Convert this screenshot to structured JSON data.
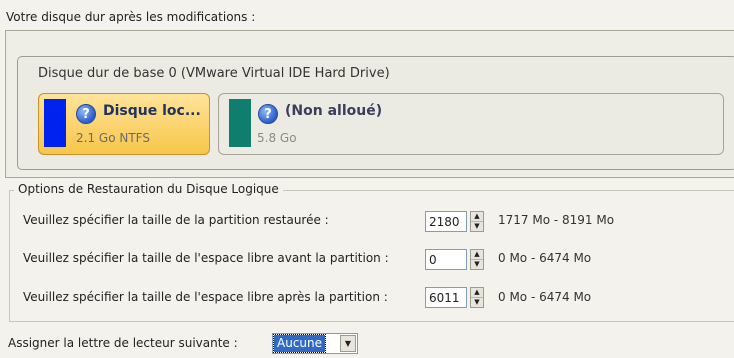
{
  "after_label": "Votre disque dur après les modifications :",
  "disk": {
    "title": "Disque dur de base 0 (VMware Virtual IDE Hard Drive)",
    "partitions": [
      {
        "name": "Disque loc...",
        "size": "2.1 Go NTFS",
        "color": "#0022ee",
        "icon": "question-icon",
        "selected": true
      },
      {
        "name": "(Non alloué)",
        "size": "5.8 Go",
        "color": "#0f7e6e",
        "icon": "question-icon",
        "selected": false
      }
    ]
  },
  "options": {
    "legend": "Options de Restauration du Disque Logique",
    "rows": [
      {
        "label": "Veuillez spécifier la taille de la partition restaurée :",
        "value": "2180",
        "range": "1717 Mo - 8191 Mo"
      },
      {
        "label": "Veuillez spécifier la taille de l'espace libre avant la partition :",
        "value": "0",
        "range": "0 Mo - 6474 Mo"
      },
      {
        "label": "Veuillez spécifier la taille de l'espace libre après la partition :",
        "value": "6011",
        "range": "0 Mo - 6474 Mo"
      }
    ]
  },
  "assign": {
    "label": "Assigner la lettre de lecteur suivante :",
    "selected": "Aucune"
  },
  "icons": {
    "spin_up": "▲",
    "spin_down": "▼",
    "dropdown": "▼",
    "question": "?"
  }
}
